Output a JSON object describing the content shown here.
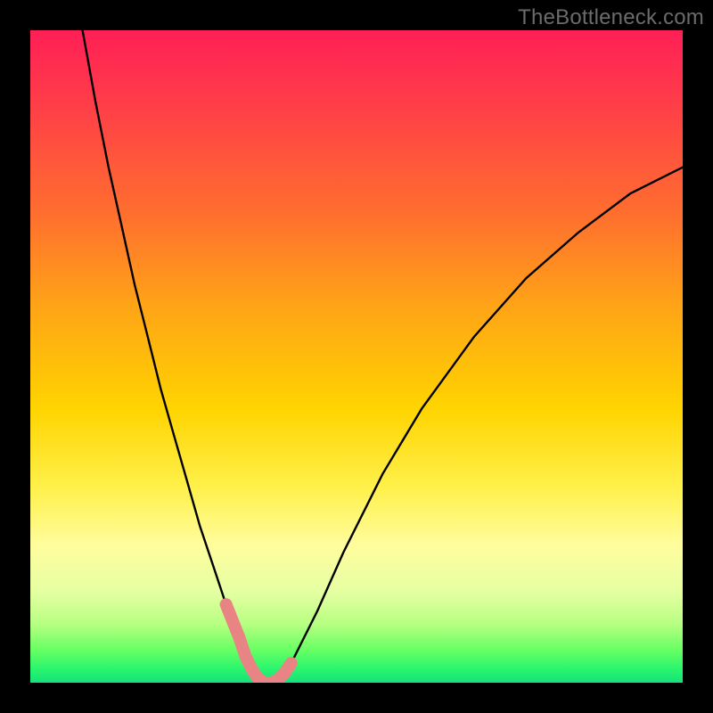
{
  "watermark": "TheBottleneck.com",
  "chart_data": {
    "type": "line",
    "title": "",
    "xlabel": "",
    "ylabel": "",
    "xlim": [
      0,
      100
    ],
    "ylim": [
      0,
      100
    ],
    "grid": false,
    "series": [
      {
        "name": "bottleneck-curve",
        "x": [
          8,
          10,
          12,
          14,
          16,
          18,
          20,
          22,
          24,
          26,
          28,
          30,
          32,
          33,
          34,
          35,
          36,
          38,
          40,
          44,
          48,
          54,
          60,
          68,
          76,
          84,
          92,
          100
        ],
        "y": [
          100,
          89,
          79,
          70,
          61,
          53,
          45,
          38,
          31,
          24,
          18,
          12,
          7,
          4,
          2,
          0.5,
          0,
          0.5,
          3,
          11,
          20,
          32,
          42,
          53,
          62,
          69,
          75,
          79
        ]
      },
      {
        "name": "highlight-segment",
        "x": [
          30,
          31,
          32,
          33,
          34,
          35,
          36,
          37,
          38,
          39,
          40
        ],
        "y": [
          12,
          9.5,
          7,
          4,
          2,
          0.5,
          0,
          0,
          0.5,
          1.5,
          3
        ]
      }
    ],
    "colors": {
      "curve": "#000000",
      "highlight": "#e98484",
      "gradient_top": "#ff1f56",
      "gradient_bottom": "#16e07a"
    }
  }
}
